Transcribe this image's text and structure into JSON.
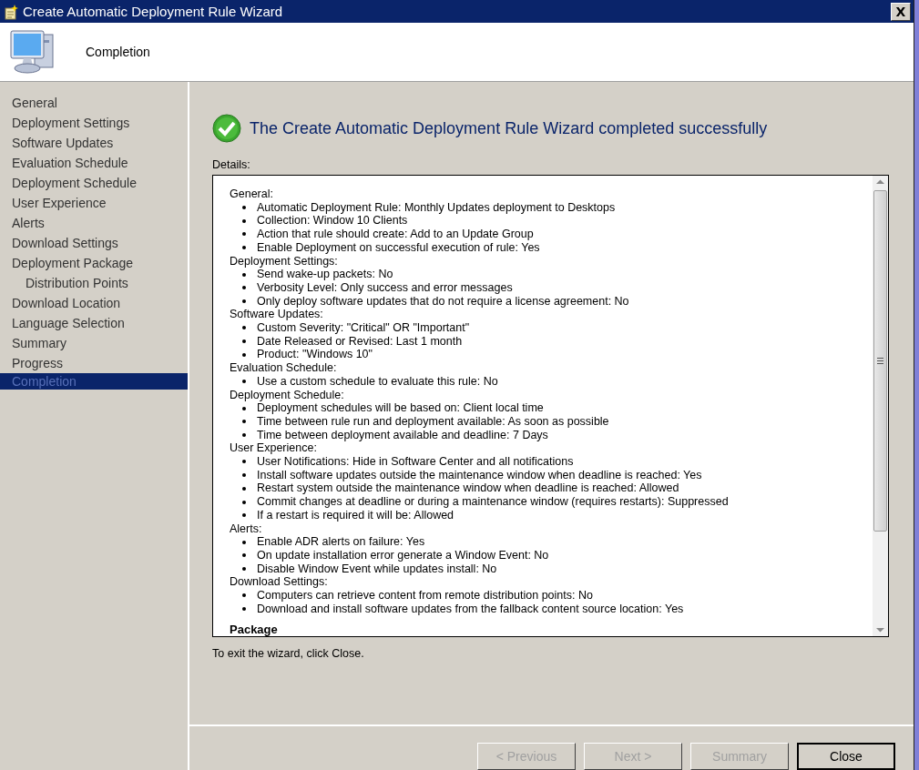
{
  "window": {
    "title": "Create Automatic Deployment Rule Wizard",
    "close": "X"
  },
  "header": {
    "page_title": "Completion"
  },
  "sidebar": {
    "items": [
      {
        "label": "General",
        "selected": false
      },
      {
        "label": "Deployment Settings",
        "selected": false
      },
      {
        "label": "Software Updates",
        "selected": false
      },
      {
        "label": "Evaluation Schedule",
        "selected": false
      },
      {
        "label": "Deployment Schedule",
        "selected": false
      },
      {
        "label": "User Experience",
        "selected": false
      },
      {
        "label": "Alerts",
        "selected": false
      },
      {
        "label": "Download Settings",
        "selected": false
      },
      {
        "label": "Deployment Package",
        "selected": false,
        "children": [
          {
            "label": "Distribution Points",
            "selected": false
          }
        ]
      },
      {
        "label": "Download Location",
        "selected": false
      },
      {
        "label": "Language Selection",
        "selected": false
      },
      {
        "label": "Summary",
        "selected": false
      },
      {
        "label": "Progress",
        "selected": false
      },
      {
        "label": "Completion",
        "selected": true
      }
    ]
  },
  "main": {
    "status_message": "The Create Automatic Deployment Rule Wizard completed successfully",
    "details_label": "Details:",
    "details": [
      {
        "heading": "General:",
        "items": [
          "Automatic Deployment Rule: Monthly Updates deployment to Desktops",
          "Collection: Window 10 Clients",
          "Action that rule should create: Add to an Update Group",
          "Enable Deployment on successful execution of rule: Yes"
        ]
      },
      {
        "heading": "Deployment Settings:",
        "items": [
          "Send wake-up packets: No",
          "Verbosity Level: Only success and error messages",
          "Only deploy software updates that do not require a license agreement: No"
        ]
      },
      {
        "heading": "Software Updates:",
        "items": [
          "Custom Severity: \"Critical\" OR \"Important\"",
          "Date Released or Revised: Last 1 month",
          "Product: \"Windows 10\""
        ]
      },
      {
        "heading": "Evaluation Schedule:",
        "items": [
          "Use a custom schedule to evaluate this rule: No"
        ]
      },
      {
        "heading": "Deployment Schedule:",
        "items": [
          "Deployment schedules will be based on: Client local time",
          "Time between rule run and deployment available: As soon as possible",
          "Time between deployment available and deadline: 7 Days"
        ]
      },
      {
        "heading": "User Experience:",
        "items": [
          "User Notifications: Hide in Software Center and all notifications",
          "Install software updates outside the maintenance window when deadline is reached: Yes",
          "Restart system outside the maintenance window when deadline is reached: Allowed",
          "Commit changes at deadline or during a maintenance window (requires restarts): Suppressed",
          "If a restart is required it will be: Allowed"
        ]
      },
      {
        "heading": "Alerts:",
        "items": [
          "Enable ADR alerts on failure: Yes",
          "On update installation error generate a Window Event: No",
          "Disable Window Event while updates install: No"
        ]
      },
      {
        "heading": "Download Settings:",
        "items": [
          "Computers can retrieve content from remote distribution points: No",
          "Download and install software updates from the fallback content source location: Yes"
        ]
      }
    ],
    "details_next_section": "Package",
    "exit_hint": "To exit the wizard, click Close."
  },
  "buttons": [
    {
      "label": "< Previous",
      "disabled": true
    },
    {
      "label": "Next >",
      "disabled": true
    },
    {
      "label": "Summary",
      "disabled": true
    },
    {
      "label": "Close",
      "disabled": false
    }
  ]
}
